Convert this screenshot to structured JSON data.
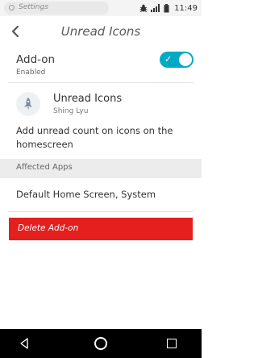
{
  "statusbar": {
    "search_placeholder": "Settings",
    "time": "11:49"
  },
  "header": {
    "title": "Unread Icons",
    "back_icon": "chevron-left-icon"
  },
  "addon_toggle": {
    "label": "Add-on",
    "status": "Enabled",
    "enabled": true,
    "accent_color": "#00aac5"
  },
  "app": {
    "name": "Unread Icons",
    "author": "Shing Lyu",
    "icon": "rocket-icon",
    "description": "Add unread count on icons on the homescreen"
  },
  "affected_apps": {
    "header": "Affected Apps",
    "value": "Default Home Screen, System"
  },
  "delete_button": {
    "label": "Delete Add-on",
    "color": "#e51e1e"
  }
}
